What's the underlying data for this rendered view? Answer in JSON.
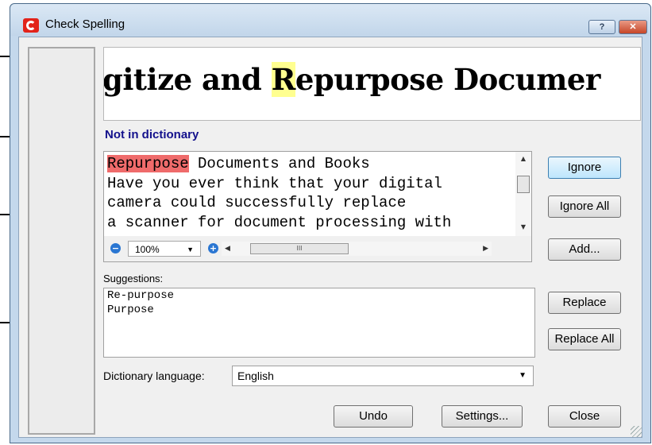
{
  "window": {
    "title": "Check Spelling",
    "help_label": "?",
    "close_label": "✕"
  },
  "preview": {
    "before": "gitize and ",
    "highlight": "R",
    "after": "epurpose Documer"
  },
  "status": "Not in dictionary",
  "context": {
    "error_word": "Repurpose",
    "line1_rest": " Documents and Books",
    "line2": "Have you ever think that your digital",
    "line3": "camera could successfully replace",
    "line4": "a scanner for document processing with"
  },
  "zoom": {
    "value": "100%",
    "minus": "−",
    "plus": "+",
    "thumb_grip": "III"
  },
  "suggestions": {
    "label": "Suggestions:",
    "items": [
      "Re-purpose",
      "Purpose"
    ]
  },
  "dictionary": {
    "label": "Dictionary language:",
    "value": "English"
  },
  "buttons": {
    "ignore": "Ignore",
    "ignore_all": "Ignore All",
    "add": "Add...",
    "replace": "Replace",
    "replace_all": "Replace All",
    "undo": "Undo",
    "settings": "Settings...",
    "close": "Close"
  },
  "colors": {
    "error_highlight": "#ef6b6b",
    "preview_highlight": "#ffff90",
    "status_text": "#13118c"
  }
}
